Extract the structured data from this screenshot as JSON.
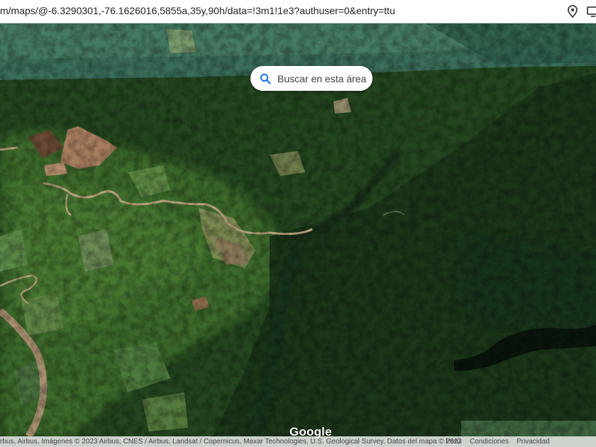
{
  "browser": {
    "url": "m/maps/@-6.3290301,-76.1626016,5855a,35y,90h/data=!3m1!1e3?authuser=0&entry=ttu",
    "icons": [
      "location-pin-icon",
      "display-icon"
    ]
  },
  "map": {
    "search_area_label": "Buscar en esta área",
    "logo": "Google"
  },
  "footer": {
    "attribution": "rbus, Airbus, Imágenes © 2023 Airbus, CNES / Airbus, Landsat / Copernicus, Maxar Technologies, U.S. Geological Survey, Datos del mapa © 2023",
    "country": "Perú",
    "terms": "Condiciones",
    "privacy": "Privacidad"
  }
}
